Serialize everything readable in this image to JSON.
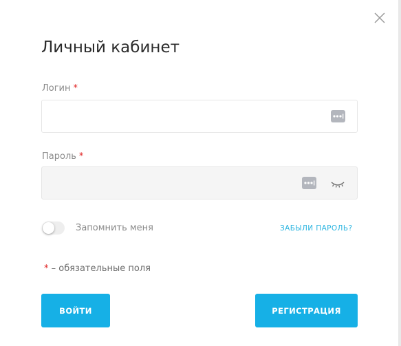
{
  "modal": {
    "title": "Личный кабинет",
    "close_icon": "close-icon"
  },
  "login": {
    "label": "Логин",
    "required_mark": "*",
    "value": "",
    "placeholder": "",
    "icon": "password-dots-icon"
  },
  "password": {
    "label": "Пароль",
    "required_mark": "*",
    "value": "",
    "placeholder": "",
    "icon": "password-dots-icon",
    "toggle_icon": "eye-closed-icon"
  },
  "remember": {
    "label": "Запомнить меня",
    "checked": false
  },
  "forgot_link": "ЗАБЫЛИ ПАРОЛЬ?",
  "required_note": {
    "mark": "*",
    "text": " – обязательные поля"
  },
  "buttons": {
    "login": "ВОЙТИ",
    "register": "РЕГИСТРАЦИЯ"
  },
  "colors": {
    "accent": "#16b0e6",
    "link": "#2ab4e0",
    "required": "#e02323",
    "label": "#8a8a8a"
  }
}
